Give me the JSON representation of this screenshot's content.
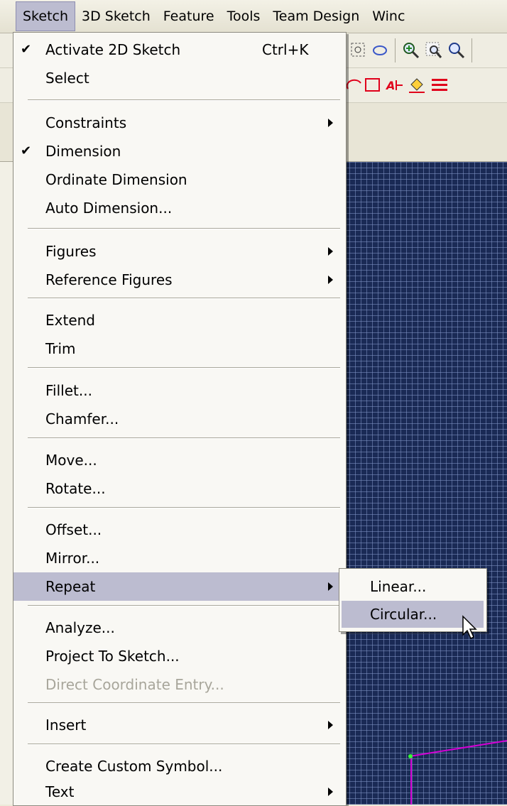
{
  "menubar": {
    "items": [
      {
        "label": "Sketch",
        "active": true
      },
      {
        "label": "3D Sketch",
        "active": false
      },
      {
        "label": "Feature",
        "active": false
      },
      {
        "label": "Tools",
        "active": false
      },
      {
        "label": "Team Design",
        "active": false
      },
      {
        "label": "Winc",
        "active": false
      }
    ]
  },
  "sketch_menu": {
    "activate_2d_sketch": {
      "label": "Activate 2D Sketch",
      "shortcut": "Ctrl+K",
      "checked": true
    },
    "select": {
      "label": "Select"
    },
    "constraints": {
      "label": "Constraints"
    },
    "dimension": {
      "label": "Dimension",
      "checked": true
    },
    "ordinate_dimension": {
      "label": "Ordinate Dimension"
    },
    "auto_dimension": {
      "label": "Auto Dimension..."
    },
    "figures": {
      "label": "Figures"
    },
    "reference_figures": {
      "label": "Reference Figures"
    },
    "extend": {
      "label": "Extend"
    },
    "trim": {
      "label": "Trim"
    },
    "fillet": {
      "label": "Fillet..."
    },
    "chamfer": {
      "label": "Chamfer..."
    },
    "move": {
      "label": "Move..."
    },
    "rotate": {
      "label": "Rotate..."
    },
    "offset": {
      "label": "Offset..."
    },
    "mirror": {
      "label": "Mirror..."
    },
    "repeat": {
      "label": "Repeat",
      "highlighted": true
    },
    "analyze": {
      "label": "Analyze..."
    },
    "project_to_sketch": {
      "label": "Project To Sketch..."
    },
    "direct_coordinate_entry": {
      "label": "Direct Coordinate Entry...",
      "disabled": true
    },
    "insert": {
      "label": "Insert"
    },
    "create_custom_symbol": {
      "label": "Create Custom Symbol..."
    },
    "text": {
      "label": "Text"
    }
  },
  "check_glyph": "✔",
  "repeat_submenu": {
    "linear": {
      "label": "Linear..."
    },
    "circular": {
      "label": "Circular...",
      "highlighted": true
    }
  },
  "colors": {
    "highlight": "#bcbcd0",
    "canvas": "#1a2a55",
    "sketch_line": "#d400d4",
    "sketch_point": "#33ff33"
  }
}
